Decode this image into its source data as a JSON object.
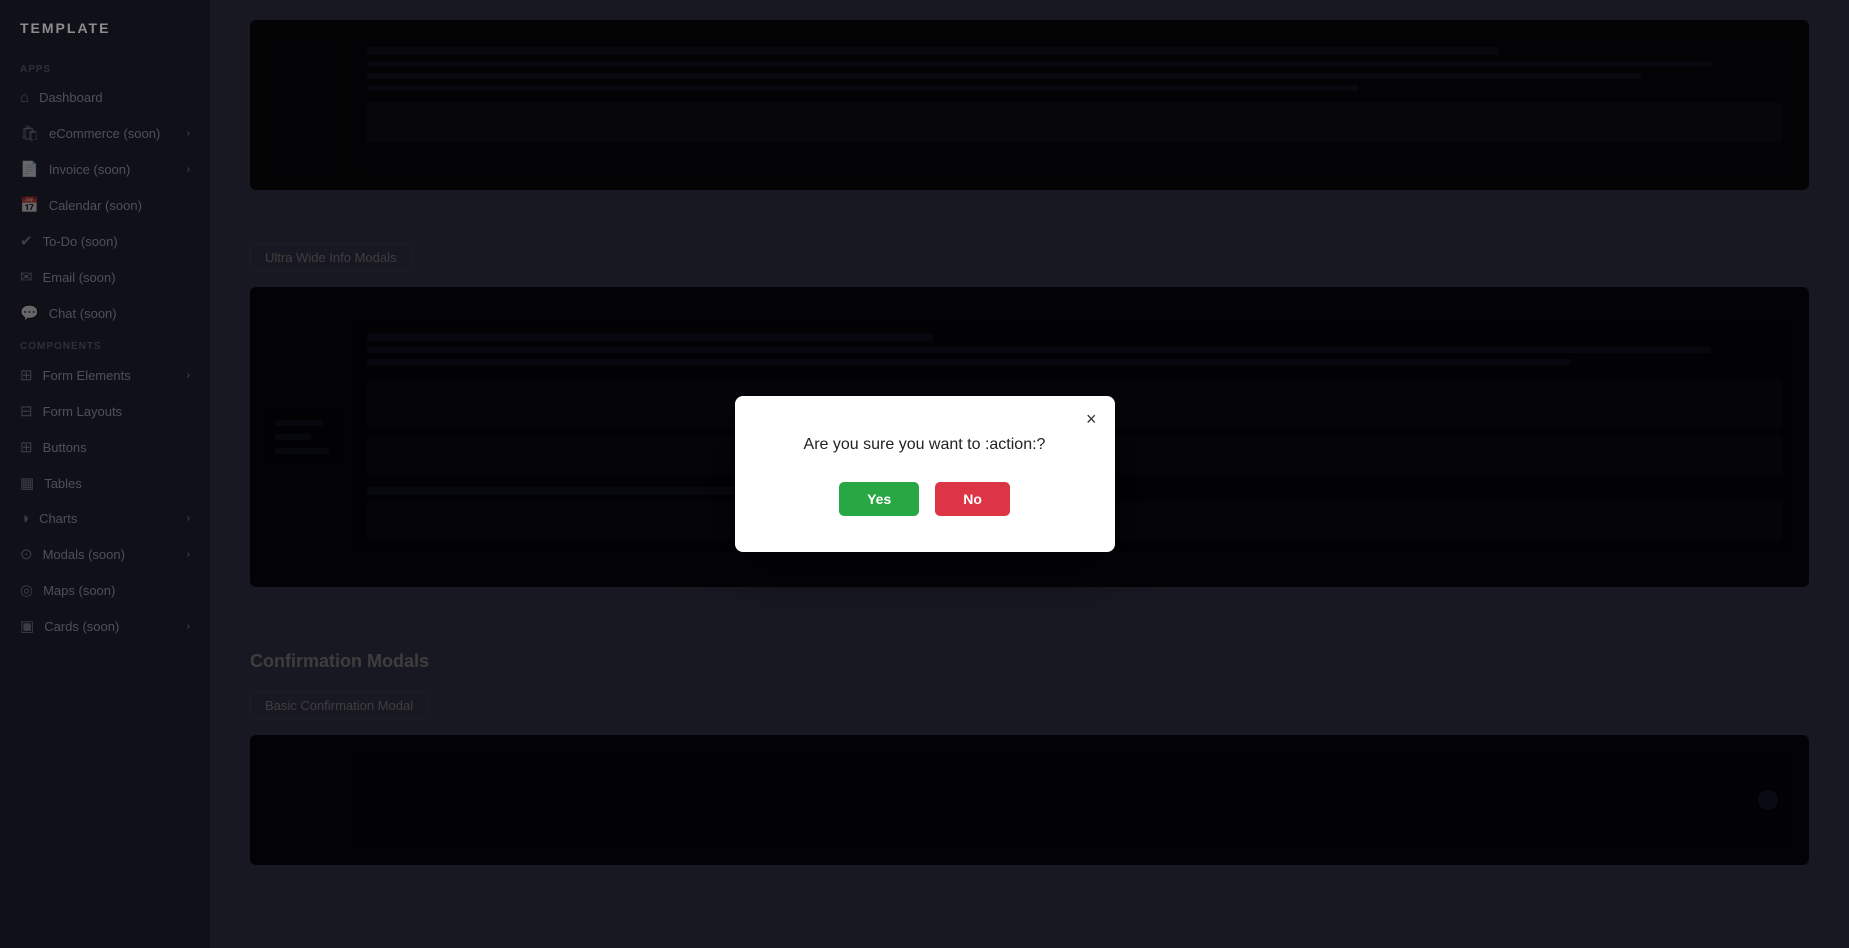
{
  "sidebar": {
    "logo": "TEMPLATE",
    "sections": [
      {
        "label": "APPS",
        "items": [
          {
            "id": "dashboard",
            "icon": "⌂",
            "label": "Dashboard",
            "arrow": false
          },
          {
            "id": "ecommerce",
            "icon": "🛍",
            "label": "eCommerce (soon)",
            "arrow": true
          },
          {
            "id": "invoice",
            "icon": "📄",
            "label": "Invoice (soon)",
            "arrow": true
          },
          {
            "id": "calendar",
            "icon": "📅",
            "label": "Calendar (soon)",
            "arrow": false
          },
          {
            "id": "todo",
            "icon": "✔",
            "label": "To-Do (soon)",
            "arrow": false
          },
          {
            "id": "email",
            "icon": "✉",
            "label": "Email (soon)",
            "arrow": false
          },
          {
            "id": "chat",
            "icon": "💬",
            "label": "Chat (soon)",
            "arrow": false
          }
        ]
      },
      {
        "label": "COMPONENTS",
        "items": [
          {
            "id": "form-elements",
            "icon": "⊞",
            "label": "Form Elements",
            "arrow": true
          },
          {
            "id": "form-layouts",
            "icon": "⊟",
            "label": "Form Layouts",
            "arrow": false
          },
          {
            "id": "buttons",
            "icon": "⊞",
            "label": "Buttons",
            "arrow": false
          },
          {
            "id": "tables",
            "icon": "▦",
            "label": "Tables",
            "arrow": false
          },
          {
            "id": "charts",
            "icon": "◑",
            "label": "Charts",
            "arrow": true
          },
          {
            "id": "modals",
            "icon": "⊙",
            "label": "Modals (soon)",
            "arrow": true
          },
          {
            "id": "maps",
            "icon": "◎",
            "label": "Maps (soon)",
            "arrow": false
          },
          {
            "id": "cards",
            "icon": "▣",
            "label": "Cards (soon)",
            "arrow": true
          }
        ]
      }
    ]
  },
  "main": {
    "ultra_wide_label": "Ultra Wide Info Modals",
    "confirmation_title": "Confirmation Modals",
    "basic_confirmation_label": "Basic Confirmation Modal"
  },
  "modal": {
    "message": "Are you sure you want to :action:?",
    "yes_label": "Yes",
    "no_label": "No",
    "close_label": "×"
  },
  "colors": {
    "yes_bg": "#28a745",
    "no_bg": "#dc3545",
    "modal_bg": "#ffffff"
  }
}
